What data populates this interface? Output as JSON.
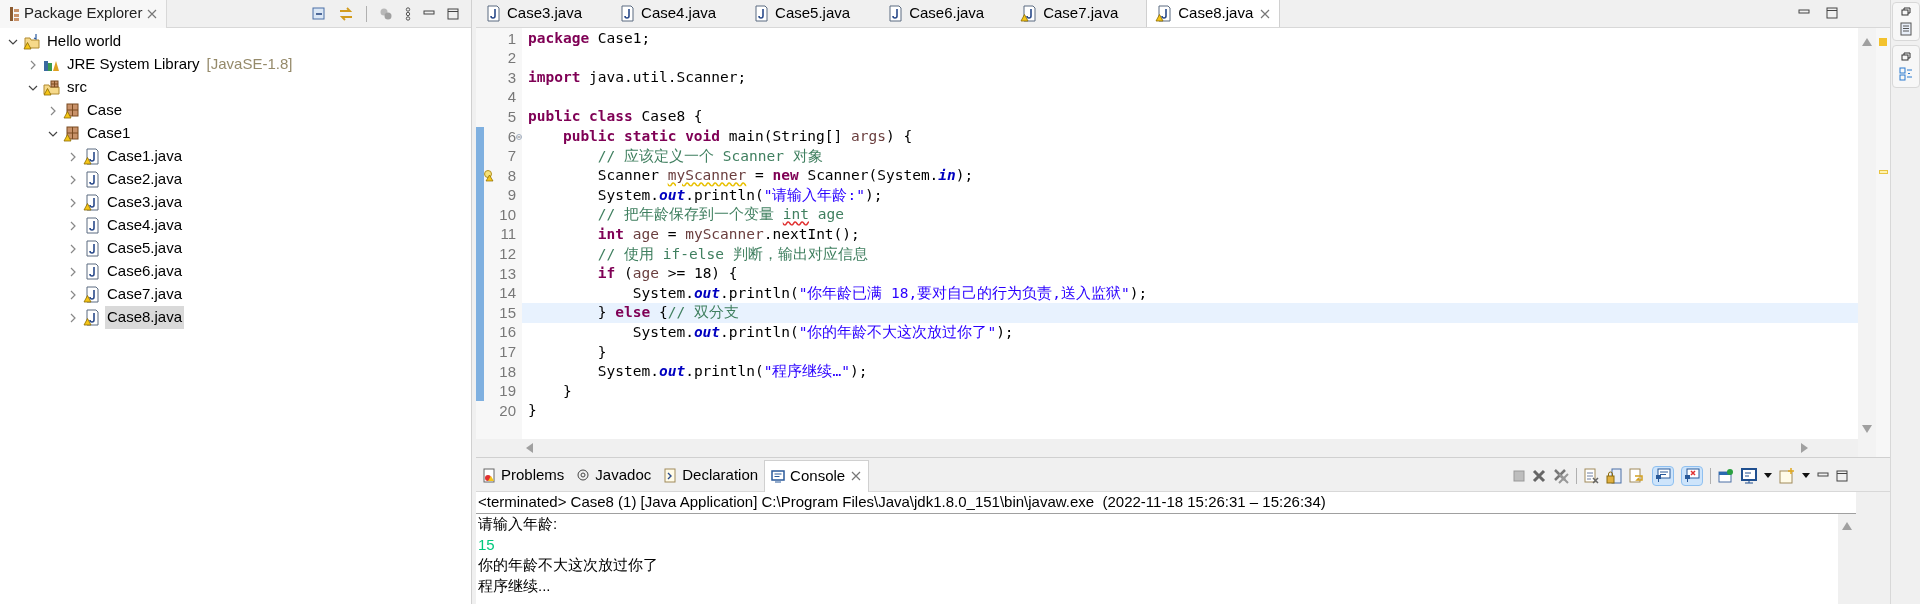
{
  "package_explorer": {
    "title": "Package Explorer",
    "tree": [
      {
        "label": "Hello world",
        "kind": "project",
        "expanded": true,
        "selected": false,
        "warning": true,
        "children": [
          {
            "label": "JRE System Library",
            "decoration": "[JavaSE-1.8]",
            "kind": "library",
            "expanded": false,
            "selected": false,
            "warning": false
          },
          {
            "label": "src",
            "kind": "source-folder",
            "expanded": true,
            "selected": false,
            "warning": true,
            "children": [
              {
                "label": "Case",
                "kind": "package",
                "expanded": false,
                "selected": false,
                "warning": true
              },
              {
                "label": "Case1",
                "kind": "package",
                "expanded": true,
                "selected": false,
                "warning": true,
                "children": [
                  {
                    "label": "Case1.java",
                    "kind": "java-file",
                    "expanded": false,
                    "selected": false,
                    "warning": true
                  },
                  {
                    "label": "Case2.java",
                    "kind": "java-file",
                    "expanded": false,
                    "selected": false,
                    "warning": false
                  },
                  {
                    "label": "Case3.java",
                    "kind": "java-file",
                    "expanded": false,
                    "selected": false,
                    "warning": true
                  },
                  {
                    "label": "Case4.java",
                    "kind": "java-file",
                    "expanded": false,
                    "selected": false,
                    "warning": false
                  },
                  {
                    "label": "Case5.java",
                    "kind": "java-file",
                    "expanded": false,
                    "selected": false,
                    "warning": false
                  },
                  {
                    "label": "Case6.java",
                    "kind": "java-file",
                    "expanded": false,
                    "selected": false,
                    "warning": false
                  },
                  {
                    "label": "Case7.java",
                    "kind": "java-file",
                    "expanded": false,
                    "selected": false,
                    "warning": true
                  },
                  {
                    "label": "Case8.java",
                    "kind": "java-file",
                    "expanded": false,
                    "selected": true,
                    "warning": true
                  }
                ]
              }
            ]
          }
        ]
      }
    ]
  },
  "editor": {
    "tabs": [
      {
        "label": "Case3.java",
        "selected": false,
        "warning": false
      },
      {
        "label": "Case4.java",
        "selected": false,
        "warning": false
      },
      {
        "label": "Case5.java",
        "selected": false,
        "warning": false
      },
      {
        "label": "Case6.java",
        "selected": false,
        "warning": false
      },
      {
        "label": "Case7.java",
        "selected": false,
        "warning": true
      },
      {
        "label": "Case8.java",
        "selected": true,
        "warning": true
      }
    ],
    "lines": [
      {
        "number": "1",
        "foldable": false,
        "warning": false,
        "changed": false,
        "current": false,
        "tokens": [
          {
            "kind": "keyword",
            "text": "package"
          },
          {
            "kind": "plain",
            "text": " Case1;"
          }
        ]
      },
      {
        "number": "2",
        "foldable": false,
        "warning": false,
        "changed": false,
        "current": false
      },
      {
        "number": "3",
        "foldable": false,
        "warning": false,
        "changed": false,
        "current": false,
        "tokens": [
          {
            "kind": "keyword",
            "text": "import"
          },
          {
            "kind": "plain",
            "text": " java.util.Scanner;"
          }
        ]
      },
      {
        "number": "4",
        "foldable": false,
        "warning": false,
        "changed": false,
        "current": false
      },
      {
        "number": "5",
        "foldable": false,
        "warning": false,
        "changed": false,
        "current": false,
        "tokens": [
          {
            "kind": "keyword",
            "text": "public class"
          },
          {
            "kind": "plain",
            "text": " Case8 {"
          }
        ]
      },
      {
        "number": "6",
        "foldable": true,
        "warning": false,
        "changed": true,
        "current": false,
        "tokens": [
          {
            "kind": "keyword",
            "text": "    public static void"
          },
          {
            "kind": "plain",
            "text": " main(String[] "
          },
          {
            "kind": "local",
            "text": "args"
          },
          {
            "kind": "plain",
            "text": ") {"
          }
        ]
      },
      {
        "number": "7",
        "foldable": false,
        "warning": false,
        "changed": true,
        "current": false,
        "tokens": [
          {
            "kind": "comment",
            "text": "        // 应该定义一个 Scanner 对象"
          }
        ]
      },
      {
        "number": "8",
        "foldable": false,
        "warning": true,
        "changed": true,
        "current": false,
        "tokens": [
          {
            "kind": "plain",
            "text": "        Scanner "
          },
          {
            "kind": "local-warning",
            "text": "myScanner"
          },
          {
            "kind": "plain",
            "text": " = "
          },
          {
            "kind": "keyword",
            "text": "new"
          },
          {
            "kind": "plain",
            "text": " Scanner(System."
          },
          {
            "kind": "static",
            "text": "in"
          },
          {
            "kind": "plain",
            "text": ");"
          }
        ]
      },
      {
        "number": "9",
        "foldable": false,
        "warning": false,
        "changed": true,
        "current": false,
        "tokens": [
          {
            "kind": "plain",
            "text": "        System."
          },
          {
            "kind": "static",
            "text": "out"
          },
          {
            "kind": "plain",
            "text": ".println("
          },
          {
            "kind": "string",
            "text": "\"请输入年龄:\""
          },
          {
            "kind": "plain",
            "text": ");"
          }
        ]
      },
      {
        "number": "10",
        "foldable": false,
        "warning": false,
        "changed": true,
        "current": false,
        "tokens": [
          {
            "kind": "comment",
            "text": "        // 把年龄保存到一个变量 "
          },
          {
            "kind": "comment-misspelled",
            "text": "int"
          },
          {
            "kind": "comment",
            "text": " age"
          }
        ]
      },
      {
        "number": "11",
        "foldable": false,
        "warning": false,
        "changed": true,
        "current": false,
        "tokens": [
          {
            "kind": "keyword",
            "text": "        int "
          },
          {
            "kind": "local",
            "text": "age"
          },
          {
            "kind": "plain",
            "text": " = "
          },
          {
            "kind": "local",
            "text": "myScanner"
          },
          {
            "kind": "plain",
            "text": ".nextInt();"
          }
        ]
      },
      {
        "number": "12",
        "foldable": false,
        "warning": false,
        "changed": true,
        "current": false,
        "tokens": [
          {
            "kind": "comment",
            "text": "        // 使用 if-else 判断，输出对应信息"
          }
        ]
      },
      {
        "number": "13",
        "foldable": false,
        "warning": false,
        "changed": true,
        "current": false,
        "tokens": [
          {
            "kind": "keyword",
            "text": "        if"
          },
          {
            "kind": "plain",
            "text": " ("
          },
          {
            "kind": "local",
            "text": "age"
          },
          {
            "kind": "plain",
            "text": " >= 18) {"
          }
        ]
      },
      {
        "number": "14",
        "foldable": false,
        "warning": false,
        "changed": true,
        "current": false,
        "tokens": [
          {
            "kind": "plain",
            "text": "            System."
          },
          {
            "kind": "static",
            "text": "out"
          },
          {
            "kind": "plain",
            "text": ".println("
          },
          {
            "kind": "string",
            "text": "\"你年龄已满 18,要对自己的行为负责,送入监狱\""
          },
          {
            "kind": "plain",
            "text": ");"
          }
        ]
      },
      {
        "number": "15",
        "foldable": false,
        "warning": false,
        "changed": true,
        "current": true,
        "tokens": [
          {
            "kind": "plain",
            "text": "        } "
          },
          {
            "kind": "keyword",
            "text": "else"
          },
          {
            "kind": "plain",
            "text": " {"
          },
          {
            "kind": "comment",
            "text": "// 双分支"
          }
        ]
      },
      {
        "number": "16",
        "foldable": false,
        "warning": false,
        "changed": true,
        "current": false,
        "tokens": [
          {
            "kind": "plain",
            "text": "            System."
          },
          {
            "kind": "static",
            "text": "out"
          },
          {
            "kind": "plain",
            "text": ".println("
          },
          {
            "kind": "string",
            "text": "\"你的年龄不大这次放过你了\""
          },
          {
            "kind": "plain",
            "text": ");"
          }
        ]
      },
      {
        "number": "17",
        "foldable": false,
        "warning": false,
        "changed": true,
        "current": false,
        "tokens": [
          {
            "kind": "plain",
            "text": "        }"
          }
        ]
      },
      {
        "number": "18",
        "foldable": false,
        "warning": false,
        "changed": true,
        "current": false,
        "tokens": [
          {
            "kind": "plain",
            "text": "        System."
          },
          {
            "kind": "static",
            "text": "out"
          },
          {
            "kind": "plain",
            "text": ".println("
          },
          {
            "kind": "string",
            "text": "\"程序继续…\""
          },
          {
            "kind": "plain",
            "text": ");"
          }
        ]
      },
      {
        "number": "19",
        "foldable": false,
        "warning": false,
        "changed": true,
        "current": false,
        "tokens": [
          {
            "kind": "plain",
            "text": "    }"
          }
        ]
      },
      {
        "number": "20",
        "foldable": false,
        "warning": false,
        "changed": false,
        "current": false,
        "tokens": [
          {
            "kind": "plain",
            "text": "}"
          }
        ]
      }
    ]
  },
  "console": {
    "tabs": [
      {
        "label": "Problems",
        "kind": "problems",
        "selected": false
      },
      {
        "label": "Javadoc",
        "kind": "javadoc",
        "selected": false
      },
      {
        "label": "Declaration",
        "kind": "declaration",
        "selected": false
      },
      {
        "label": "Console",
        "kind": "console",
        "selected": true
      }
    ],
    "status": "<terminated> Case8 (1) [Java Application] C:\\Program Files\\Java\\jdk1.8.0_151\\bin\\javaw.exe  (2022-11-18 15:26:31 – 15:26:34)",
    "output": [
      {
        "kind": "output",
        "text": "请输入年龄:"
      },
      {
        "kind": "input",
        "text": "15"
      },
      {
        "kind": "output",
        "text": "你的年龄不大这次放过你了"
      },
      {
        "kind": "output",
        "text": "程序继续..."
      }
    ]
  }
}
